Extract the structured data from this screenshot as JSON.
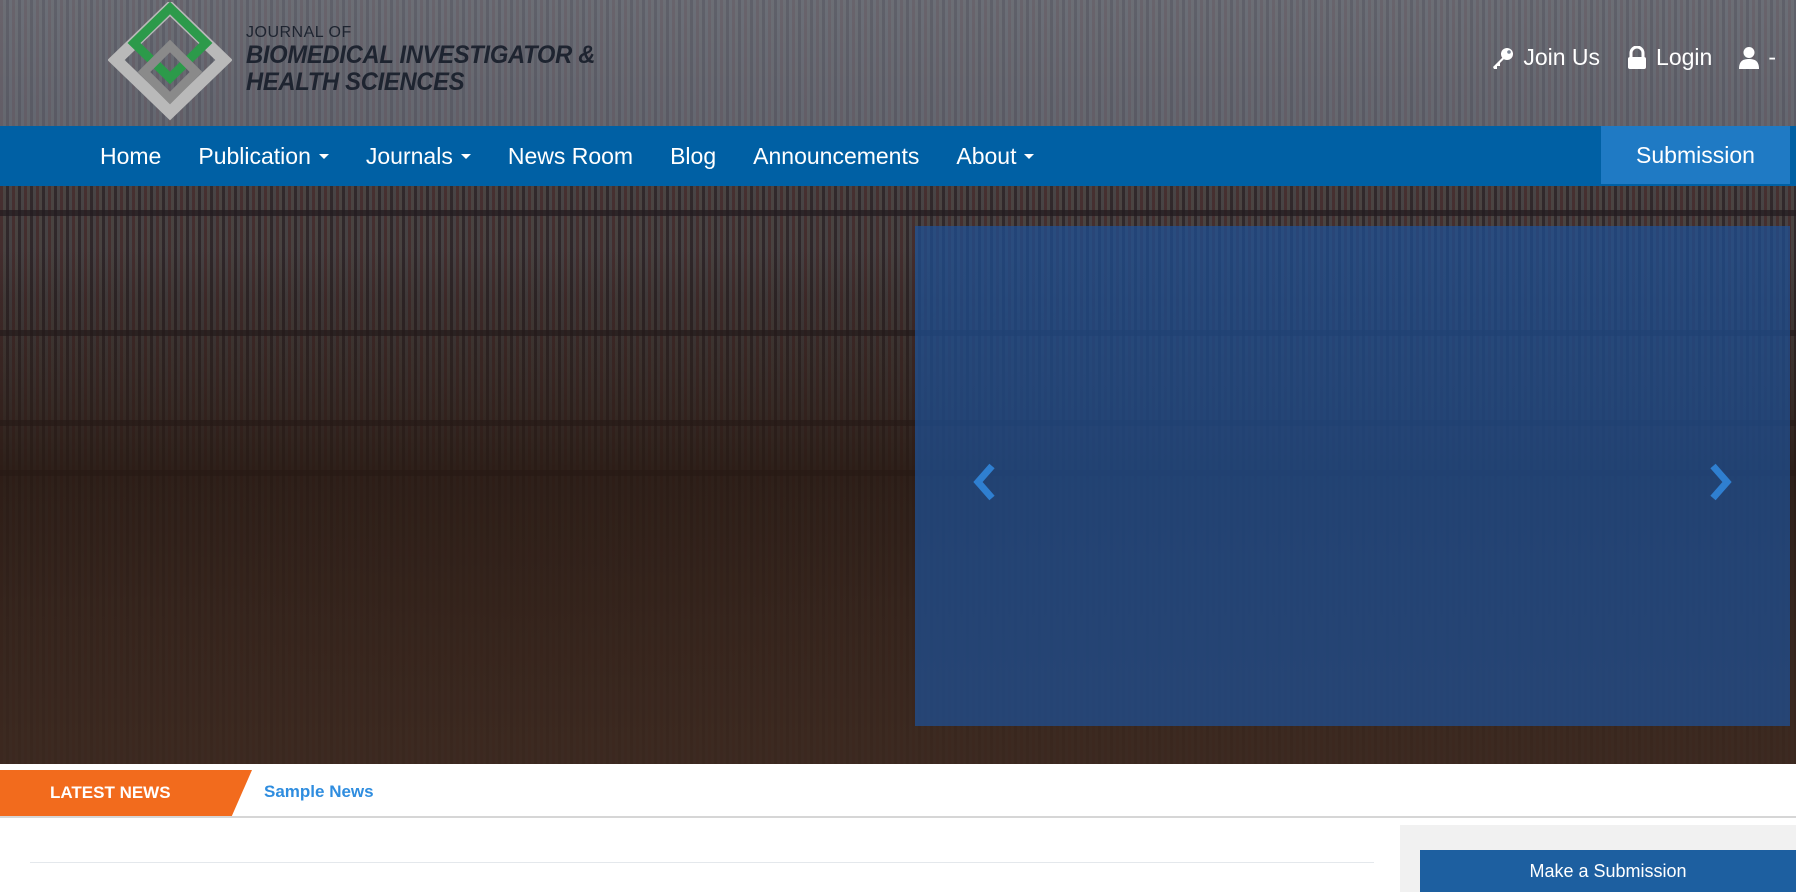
{
  "logo": {
    "line1": "JOURNAL OF",
    "line2": "BIOMEDICAL INVESTIGATOR &",
    "line3": "HEALTH SCIENCES",
    "icon": "diamond-logo-icon"
  },
  "user_links": [
    {
      "label": "Join Us",
      "icon": "key-icon"
    },
    {
      "label": "Login",
      "icon": "lock-icon"
    },
    {
      "label": "-",
      "icon": "user-icon"
    }
  ],
  "nav": {
    "items": [
      {
        "label": "Home",
        "dropdown": false
      },
      {
        "label": "Publication",
        "dropdown": true
      },
      {
        "label": "Journals",
        "dropdown": true
      },
      {
        "label": "News Room",
        "dropdown": false
      },
      {
        "label": "Blog",
        "dropdown": false
      },
      {
        "label": "Announcements",
        "dropdown": false
      },
      {
        "label": "About",
        "dropdown": true
      }
    ],
    "submission_label": "Submission"
  },
  "slider": {
    "prev_icon": "chevron-left-icon",
    "next_icon": "chevron-right-icon"
  },
  "news": {
    "label": "LATEST NEWS",
    "item": "Sample News"
  },
  "sidebar": {
    "make_submission_label": "Make a Submission"
  },
  "colors": {
    "nav_bg": "#0060a4",
    "submission_bg": "#1f7ac4",
    "news_label_bg": "#f26b1d",
    "news_link": "#2f8ddf",
    "sidebar_button_bg": "#1d5fa0"
  }
}
